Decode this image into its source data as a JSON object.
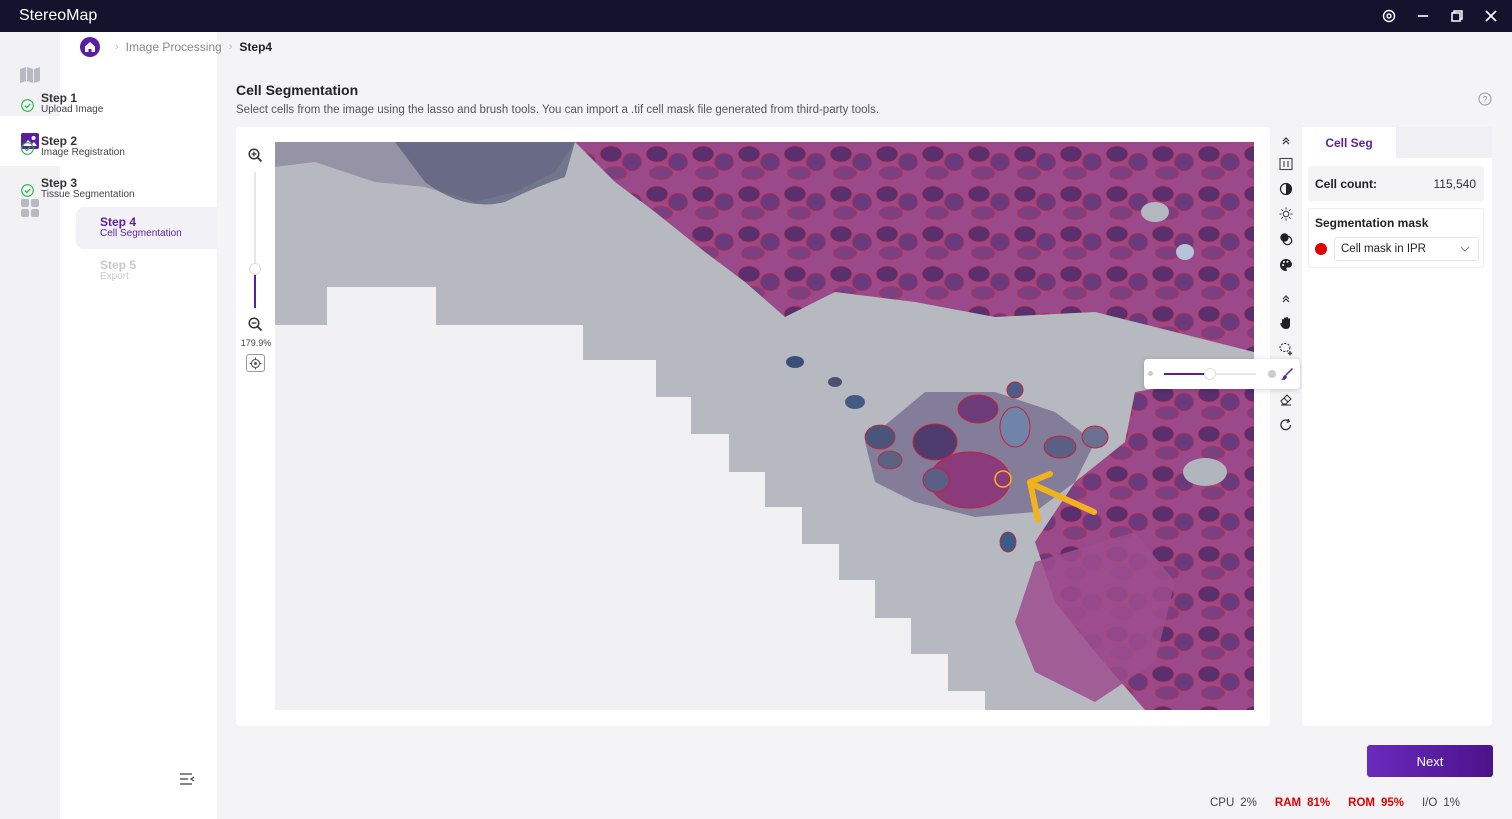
{
  "app": {
    "title": "StereoMap"
  },
  "breadcrumb": {
    "items": [
      "Image Processing"
    ],
    "current": "Step4"
  },
  "steps": [
    {
      "title": "Step 1",
      "subtitle": "Upload Image",
      "state": "done"
    },
    {
      "title": "Step 2",
      "subtitle": "Image Registration",
      "state": "done"
    },
    {
      "title": "Step 3",
      "subtitle": "Tissue Segmentation",
      "state": "done"
    },
    {
      "title": "Step 4",
      "subtitle": "Cell Segmentation",
      "state": "active"
    },
    {
      "title": "Step 5",
      "subtitle": "Export",
      "state": "disabled"
    }
  ],
  "main": {
    "title": "Cell Segmentation",
    "description": "Select cells from the image using the lasso and brush tools. You can import a .tif cell mask file generated from third-party tools."
  },
  "zoom": {
    "label": "179.9%",
    "level": 0.29
  },
  "brush": {
    "size_fraction": 0.5
  },
  "panel": {
    "tab": "Cell Seg",
    "cell_count_label": "Cell count:",
    "cell_count_value": "115,540",
    "mask_title": "Segmentation mask",
    "mask_select": "Cell mask in IPR",
    "mask_color": "#e00000"
  },
  "actions": {
    "next": "Next"
  },
  "status": [
    {
      "label": "CPU",
      "value": "2%",
      "alert": false
    },
    {
      "label": "RAM",
      "value": "81%",
      "alert": true
    },
    {
      "label": "ROM",
      "value": "95%",
      "alert": true
    },
    {
      "label": "I/O",
      "value": "1%",
      "alert": false
    }
  ],
  "colors": {
    "accent": "#5b1ea0",
    "titlebar": "#15122e",
    "annotation": "#f2b21c"
  }
}
